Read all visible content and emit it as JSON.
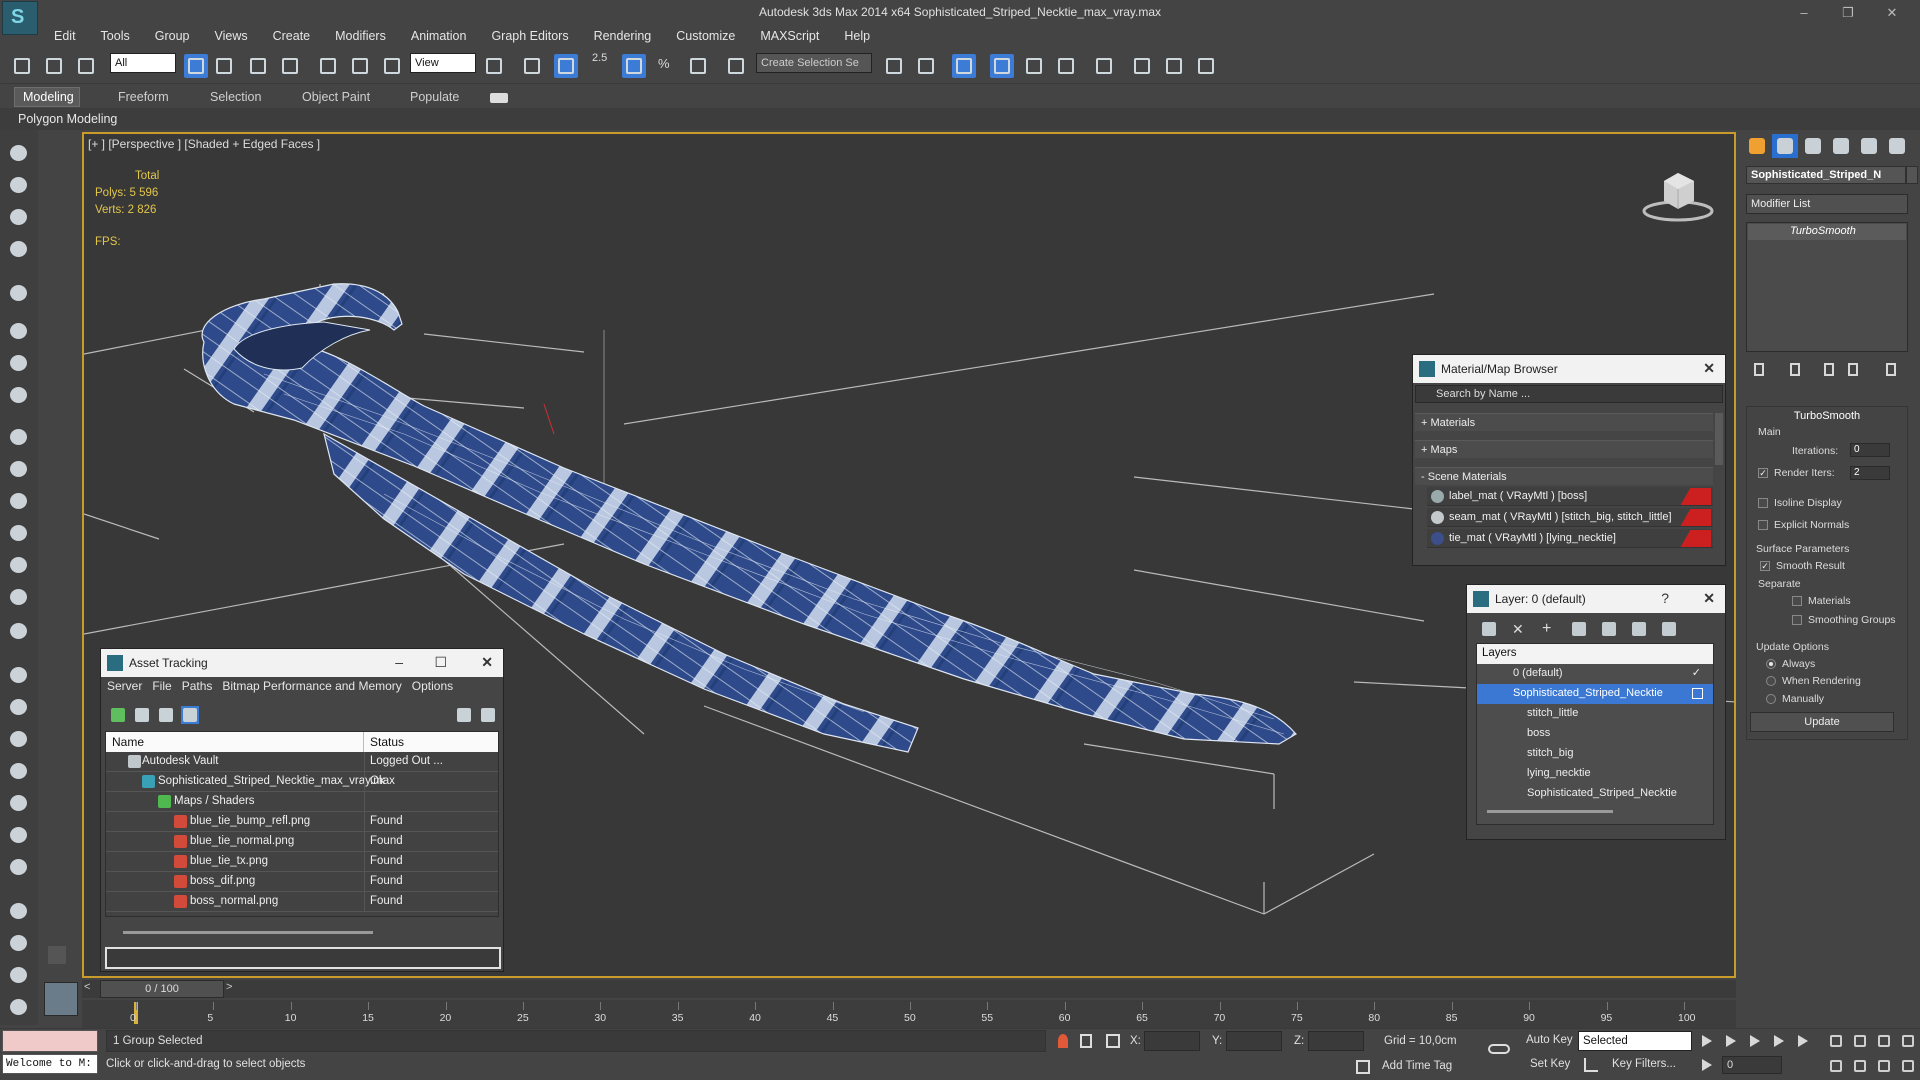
{
  "window": {
    "title": "Autodesk 3ds Max  2014 x64    Sophisticated_Striped_Necktie_max_vray.max",
    "controls": [
      "–",
      "❐",
      "✕"
    ]
  },
  "menu": [
    "Edit",
    "Tools",
    "Group",
    "Views",
    "Create",
    "Modifiers",
    "Animation",
    "Graph Editors",
    "Rendering",
    "Customize",
    "MAXScript",
    "Help"
  ],
  "toolbar": {
    "filter_value": "All",
    "refcoord_value": "View",
    "snap_label": "2.5",
    "snap_label2": "%",
    "selection_set_placeholder": "Create Selection Se"
  },
  "ribbon": {
    "tabs": [
      "Modeling",
      "Freeform",
      "Selection",
      "Object Paint",
      "Populate"
    ],
    "panel_label": "Polygon Modeling"
  },
  "viewport": {
    "label": "[+ ] [Perspective ] [Shaded + Edged Faces ]",
    "stats_header": "Total",
    "polys_label": "Polys:",
    "polys_value": "5 596",
    "verts_label": "Verts:",
    "verts_value": "2 826",
    "fps_label": "FPS:"
  },
  "command_panel": {
    "object_name": "Sophisticated_Striped_N",
    "modifier_list": "Modifier List",
    "stack_item": "TurboSmooth",
    "turbosmooth": {
      "title": "TurboSmooth",
      "main": "Main",
      "iterations_label": "Iterations:",
      "iterations_value": "0",
      "render_iters_label": "Render Iters:",
      "render_iters_value": "2",
      "isoline": "Isoline Display",
      "explicit": "Explicit Normals",
      "surface_params": "Surface Parameters",
      "smooth_result": "Smooth Result",
      "separate": "Separate",
      "materials": "Materials",
      "smoothing_groups": "Smoothing Groups",
      "update_options": "Update Options",
      "always": "Always",
      "when_rendering": "When Rendering",
      "manually": "Manually",
      "update_button": "Update"
    }
  },
  "material_browser": {
    "title": "Material/Map Browser",
    "search_placeholder": "Search by Name ...",
    "sections": [
      "+ Materials",
      "+ Maps",
      "- Scene Materials"
    ],
    "materials": [
      {
        "name": "label_mat  ( VRayMtl ) [boss]",
        "swatch": "#8a9aa0"
      },
      {
        "name": "seam_mat  ( VRayMtl ) [stitch_big, stitch_little]",
        "swatch": "#b9bfc2"
      },
      {
        "name": "tie_mat  ( VRayMtl ) [lying_necktie]",
        "swatch": "#3c4f8a"
      }
    ]
  },
  "layer_window": {
    "title": "Layer: 0 (default)",
    "help": "?",
    "header": "Layers",
    "rows": [
      {
        "name": "0 (default)",
        "type": "layer"
      },
      {
        "name": "Sophisticated_Striped_Necktie",
        "type": "layer-selected"
      },
      {
        "name": "stitch_little",
        "type": "child"
      },
      {
        "name": "boss",
        "type": "child"
      },
      {
        "name": "stitch_big",
        "type": "child"
      },
      {
        "name": "lying_necktie",
        "type": "child"
      },
      {
        "name": "Sophisticated_Striped_Necktie",
        "type": "child"
      }
    ]
  },
  "asset_tracking": {
    "title": "Asset Tracking",
    "menu": [
      "Server",
      "File",
      "Paths",
      "Bitmap Performance and Memory",
      "Options"
    ],
    "columns": [
      "Name",
      "Status"
    ],
    "rows": [
      {
        "name": "Autodesk Vault",
        "status": "Logged Out ...",
        "level": 0
      },
      {
        "name": "Sophisticated_Striped_Necktie_max_vray.max",
        "status": "Ok",
        "level": 1
      },
      {
        "name": "Maps / Shaders",
        "status": "",
        "level": 2
      },
      {
        "name": "blue_tie_bump_refl.png",
        "status": "Found",
        "level": 3
      },
      {
        "name": "blue_tie_normal.png",
        "status": "Found",
        "level": 3
      },
      {
        "name": "blue_tie_tx.png",
        "status": "Found",
        "level": 3
      },
      {
        "name": "boss_dif.png",
        "status": "Found",
        "level": 3
      },
      {
        "name": "boss_normal.png",
        "status": "Found",
        "level": 3
      }
    ]
  },
  "timeline": {
    "slider_label": "0 / 100",
    "prev": "<",
    "next": ">",
    "ticks": [
      "0",
      "5",
      "10",
      "15",
      "20",
      "25",
      "30",
      "35",
      "40",
      "45",
      "50",
      "55",
      "60",
      "65",
      "70",
      "75",
      "80",
      "85",
      "90",
      "95",
      "100"
    ]
  },
  "status": {
    "listener": "Welcome to M:",
    "selection": "1 Group Selected",
    "prompt": "Click or click-and-drag to select objects",
    "x_label": "X:",
    "y_label": "Y:",
    "z_label": "Z:",
    "grid": "Grid = 10,0cm",
    "add_time_tag": "Add Time Tag",
    "auto_key": "Auto Key",
    "set_key": "Set Key",
    "selected_value": "Selected",
    "key_filters": "Key Filters...",
    "frame_value": "0"
  }
}
